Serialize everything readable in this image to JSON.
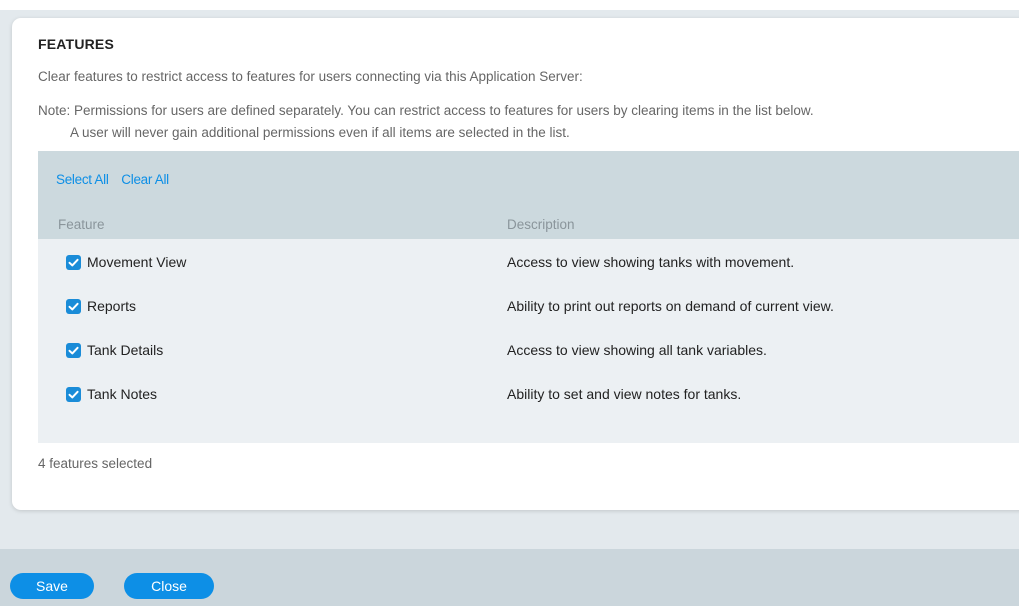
{
  "features_section": {
    "heading": "FEATURES",
    "intro": "Clear features to restrict access to features for users connecting via this Application Server:",
    "note_line1": "Note: Permissions for users are defined separately. You can restrict access to features for users by clearing items in the list below.",
    "note_line2": "A user will never gain additional permissions even if all items are selected in the list.",
    "select_all": "Select All",
    "clear_all": "Clear All",
    "columns": {
      "feature": "Feature",
      "description": "Description"
    },
    "rows": [
      {
        "name": "Movement View",
        "description": "Access to view showing tanks with movement.",
        "checked": true
      },
      {
        "name": "Reports",
        "description": "Ability to print out reports on demand of current view.",
        "checked": true
      },
      {
        "name": "Tank Details",
        "description": "Access to view showing all tank variables.",
        "checked": true
      },
      {
        "name": "Tank Notes",
        "description": "Ability to set and view notes for tanks.",
        "checked": true
      }
    ],
    "selected_count": "4 features selected"
  },
  "footer": {
    "save_label": "Save",
    "close_label": "Close"
  },
  "colors": {
    "accent": "#0d8fe6",
    "checkbox": "#1a8cd8",
    "panel": "#ccd9de",
    "rows_bg": "#ecf0f3"
  },
  "icons": {
    "checkbox": "checkmark-icon"
  }
}
